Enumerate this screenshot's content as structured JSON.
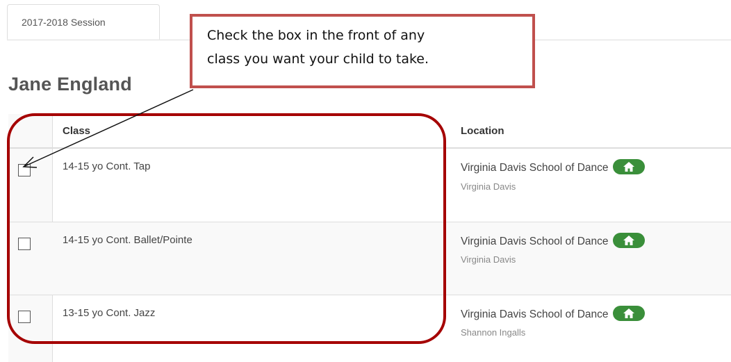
{
  "tab": {
    "label": "2017-2018 Session"
  },
  "student": {
    "name": "Jane England"
  },
  "table": {
    "headers": {
      "class": "Class",
      "location": "Location"
    },
    "rows": [
      {
        "class": "14-15 yo Cont. Tap",
        "location": "Virginia Davis School of Dance",
        "teacher": "Virginia Davis",
        "checked": false,
        "badge_icon": "home-icon"
      },
      {
        "class": "14-15 yo Cont. Ballet/Pointe",
        "location": "Virginia Davis School of Dance",
        "teacher": "Virginia Davis",
        "checked": false,
        "badge_icon": "home-icon"
      },
      {
        "class": "13-15 yo Cont. Jazz",
        "location": "Virginia Davis School of Dance",
        "teacher": "Shannon Ingalls",
        "checked": false,
        "badge_icon": "home-icon"
      }
    ]
  },
  "annotation": {
    "line1": "Check the box in the front of any",
    "line2": "class you want your child to take.",
    "callout_color": "#c0504d",
    "highlight_color": "#a50000"
  },
  "colors": {
    "badge": "#3a8f3a",
    "stripe": "#f9f9f9",
    "border": "#dddddd"
  }
}
